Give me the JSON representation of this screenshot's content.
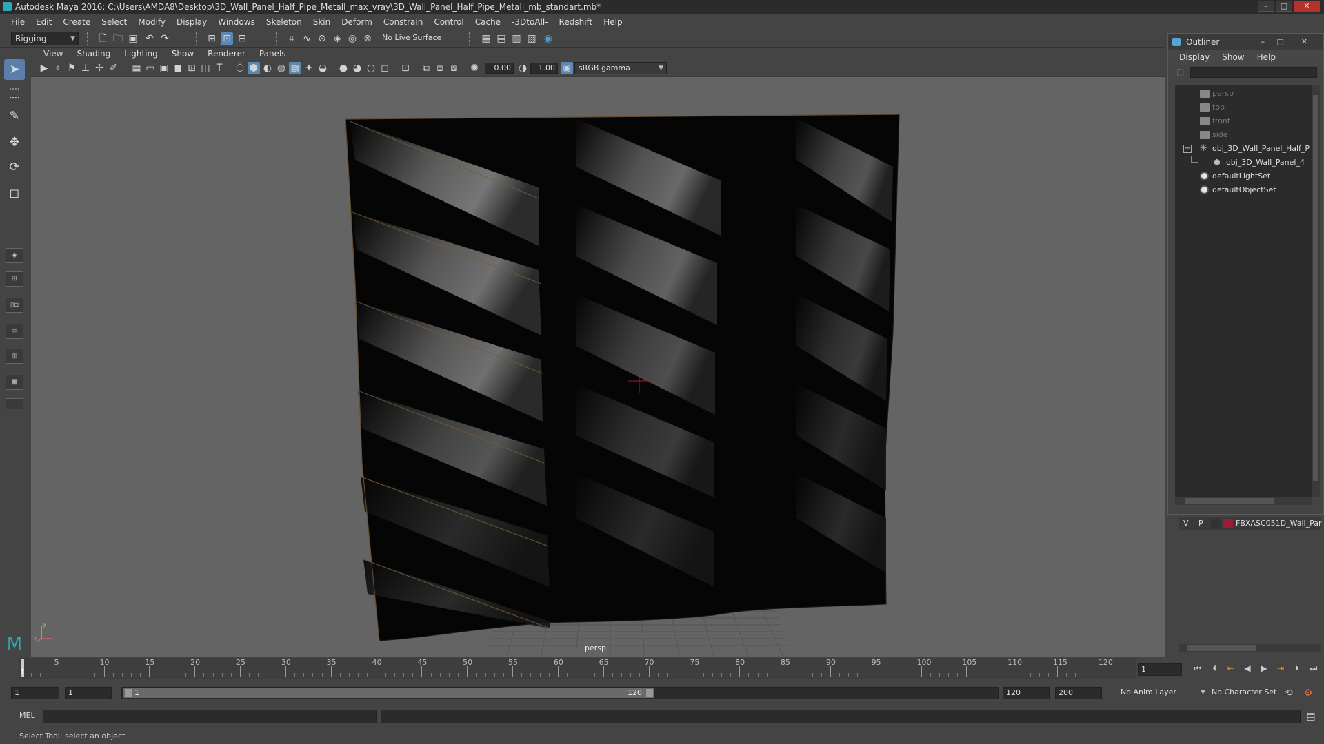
{
  "window": {
    "title": "Autodesk Maya 2016: C:\\Users\\AMDA8\\Desktop\\3D_Wall_Panel_Half_Pipe_Metall_max_vray\\3D_Wall_Panel_Half_Pipe_Metall_mb_standart.mb*",
    "minimize": "–",
    "maximize": "□",
    "close": "✕"
  },
  "menubar": [
    "File",
    "Edit",
    "Create",
    "Select",
    "Modify",
    "Display",
    "Windows",
    "Skeleton",
    "Skin",
    "Deform",
    "Constrain",
    "Control",
    "Cache",
    "-3DtoAll-",
    "Redshift",
    "Help"
  ],
  "shelf": {
    "mode": "Rigging",
    "live_surface": "No Live Surface"
  },
  "viewport": {
    "menus": [
      "View",
      "Shading",
      "Lighting",
      "Show",
      "Renderer",
      "Panels"
    ],
    "exposure": "0.00",
    "gamma": "1.00",
    "color_space": "sRGB gamma",
    "camera_label": "persp",
    "axis_labels": {
      "x": "x",
      "y": "y"
    }
  },
  "outliner": {
    "title": "Outliner",
    "menus": [
      "Display",
      "Show",
      "Help"
    ],
    "items": [
      {
        "label": "persp",
        "dim": true
      },
      {
        "label": "top",
        "dim": true
      },
      {
        "label": "front",
        "dim": true
      },
      {
        "label": "side",
        "dim": true
      },
      {
        "label": "obj_3D_Wall_Panel_Half_P",
        "dim": false
      },
      {
        "label": "obj_3D_Wall_Panel_4",
        "dim": false
      },
      {
        "label": "defaultLightSet",
        "dim": false
      },
      {
        "label": "defaultObjectSet",
        "dim": false
      }
    ],
    "expander": "−"
  },
  "layers": {
    "visible": "V",
    "playback": "P",
    "layer_name": "FBXASC051D_Wall_Par",
    "layer_color": "#9b1c31"
  },
  "timeline": {
    "ticks": [
      "5",
      "10",
      "15",
      "20",
      "25",
      "30",
      "35",
      "40",
      "45",
      "50",
      "55",
      "60",
      "65",
      "70",
      "75",
      "80",
      "85",
      "90",
      "95",
      "100",
      "105",
      "110",
      "115",
      "120"
    ],
    "current_frame_marker": "1",
    "current_frame": "1"
  },
  "range": {
    "start": "1",
    "playback_start": "1",
    "slider_start": "1",
    "slider_end": "120",
    "playback_end": "120",
    "end": "200",
    "anim_layer": "No Anim Layer",
    "character_set": "No Character Set"
  },
  "cmd": {
    "label": "MEL"
  },
  "help_line": "Select Tool: select an object"
}
